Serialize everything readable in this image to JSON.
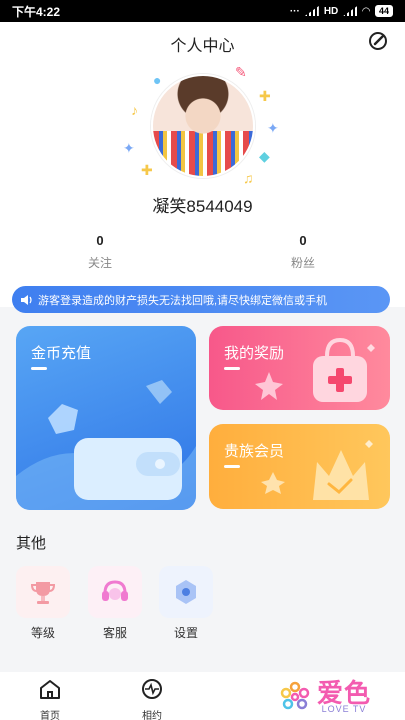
{
  "status": {
    "time": "下午4:22",
    "battery": "44",
    "network": "HD"
  },
  "header": {
    "title": "个人中心"
  },
  "profile": {
    "username": "凝笑8544049"
  },
  "stats": [
    {
      "value": "0",
      "label": "关注"
    },
    {
      "value": "0",
      "label": "粉丝"
    }
  ],
  "notice": {
    "text": "游客登录造成的财产损失无法找回哦,请尽快绑定微信或手机"
  },
  "cards": {
    "gold": {
      "title": "金币充值"
    },
    "reward": {
      "title": "我的奖励"
    },
    "vip": {
      "title": "贵族会员"
    }
  },
  "section": {
    "title": "其他"
  },
  "tools": [
    {
      "label": "等级",
      "icon": "trophy-icon"
    },
    {
      "label": "客服",
      "icon": "headset-icon"
    },
    {
      "label": "设置",
      "icon": "settings-icon"
    }
  ],
  "tabs": [
    {
      "label": "首页",
      "icon": "home-icon"
    },
    {
      "label": "相约",
      "icon": "pulse-icon"
    }
  ],
  "brand": {
    "name": "爱色",
    "sub": "LOVE TV"
  },
  "colors": {
    "accent": "#3f7ff0",
    "pink": "#f7588a",
    "orange": "#ffae3d"
  }
}
